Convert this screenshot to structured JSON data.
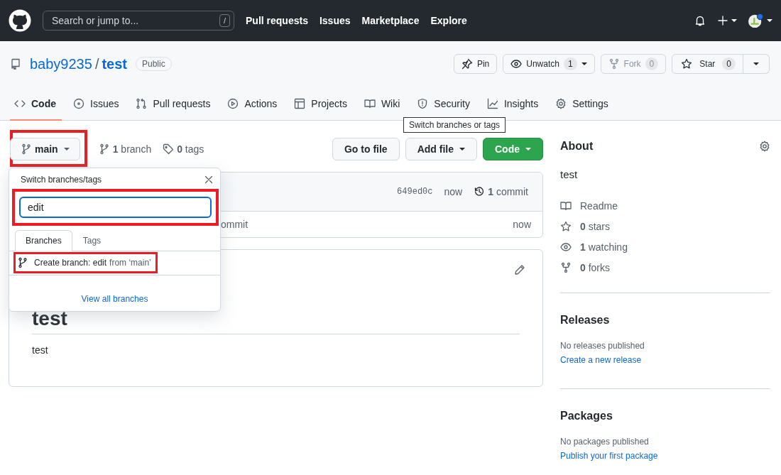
{
  "header": {
    "search_placeholder": "Search or jump to...",
    "search_key": "/",
    "nav": [
      "Pull requests",
      "Issues",
      "Marketplace",
      "Explore"
    ]
  },
  "repo": {
    "owner": "baby9235",
    "separator": "/",
    "name": "test",
    "visibility": "Public"
  },
  "repo_actions": [
    {
      "kind": "pin",
      "label": "Pin",
      "disabled": false
    },
    {
      "kind": "watch",
      "label": "Unwatch",
      "count": "1",
      "disabled": false
    },
    {
      "kind": "fork",
      "label": "Fork",
      "count": "0",
      "disabled": true
    },
    {
      "kind": "star",
      "label": "Star",
      "count": "0",
      "disabled": false
    }
  ],
  "tabs": [
    {
      "label": "Code",
      "selected": true
    },
    {
      "label": "Issues",
      "selected": false
    },
    {
      "label": "Pull requests",
      "selected": false
    },
    {
      "label": "Actions",
      "selected": false
    },
    {
      "label": "Projects",
      "selected": false
    },
    {
      "label": "Wiki",
      "selected": false
    },
    {
      "label": "Security",
      "selected": false
    },
    {
      "label": "Insights",
      "selected": false
    },
    {
      "label": "Settings",
      "selected": false
    }
  ],
  "tooltip": "Switch branches or tags",
  "branch_bar": {
    "branch_button": {
      "label": "main",
      "highlighted": true
    },
    "branches": "**1** branch",
    "tags": "**0** tags",
    "buttons": [
      {
        "label": "Go to file",
        "kind": "plain"
      },
      {
        "label": "Add file",
        "kind": "menu"
      },
      {
        "label": "Code",
        "kind": "primary"
      }
    ]
  },
  "commit_box": {
    "sha": "649ed0c",
    "time": "now",
    "commits": "**1** commit",
    "rows": [
      {
        "message": "ommit",
        "time": "now"
      }
    ]
  },
  "readme": {
    "heading": "test",
    "body": "test"
  },
  "branch_menu": {
    "title": "Switch branches/tags",
    "filter_value": "edit",
    "filter_highlighted": true,
    "tabs": [
      {
        "label": "Branches",
        "selected": true
      },
      {
        "label": "Tags",
        "selected": false
      }
    ],
    "create_item": {
      "label": "Create branch: edit",
      "suffix": "from ‘main’",
      "highlighted": true
    },
    "footer_link": "View all branches"
  },
  "about": {
    "title": "About",
    "description": "test",
    "stats": [
      {
        "kind": "book",
        "text": "Readme"
      },
      {
        "kind": "star",
        "text": "**0** stars"
      },
      {
        "kind": "eye",
        "text": "**1** watching"
      },
      {
        "kind": "fork",
        "text": "**0** forks"
      }
    ]
  },
  "releases": {
    "title": "Releases",
    "note": "No releases published",
    "link": "Create a new release"
  },
  "packages": {
    "title": "Packages",
    "note": "No packages published",
    "link": "Publish your first package"
  }
}
